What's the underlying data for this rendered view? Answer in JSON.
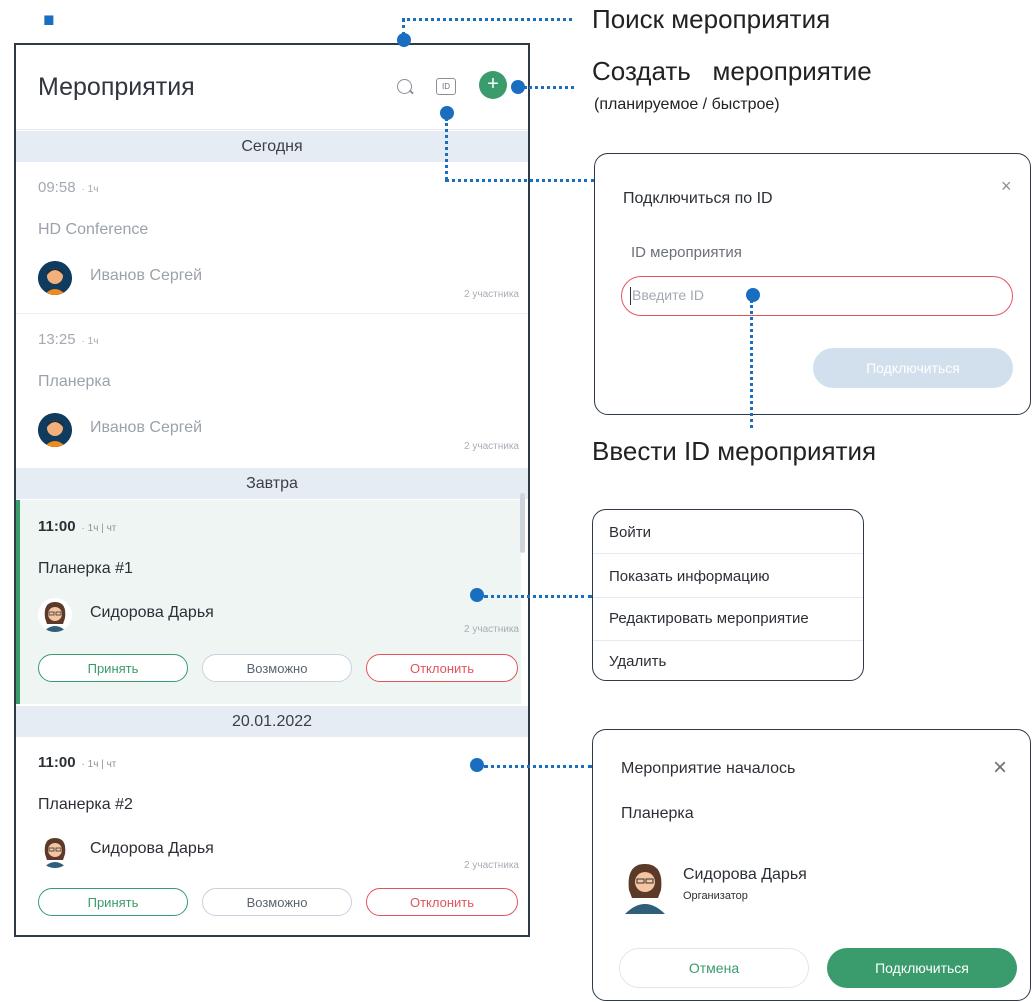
{
  "panel": {
    "title": "Мероприятия",
    "id_button": "ID",
    "add_button": "+"
  },
  "groups": [
    {
      "label": "Сегодня"
    },
    {
      "label": "Завтра"
    },
    {
      "label": "20.01.2022"
    }
  ],
  "events": [
    {
      "time": "09:58",
      "meta": "· 1ч",
      "name": "HD Conference",
      "organizer": "Иванов Сергей",
      "participants": "2 участника"
    },
    {
      "time": "13:25",
      "meta": "· 1ч",
      "name": "Планерка",
      "organizer": "Иванов Сергей",
      "participants": "2 участника"
    },
    {
      "time": "11:00",
      "meta": "· 1ч | чт",
      "name": "Планерка #1",
      "organizer": "Сидорова Дарья",
      "participants": "2 участника"
    },
    {
      "time": "11:00",
      "meta": "· 1ч | чт",
      "name": "Планерка #2",
      "organizer": "Сидорова Дарья",
      "participants": "2 участника"
    }
  ],
  "actions": {
    "accept": "Принять",
    "maybe": "Возможно",
    "decline": "Отклонить"
  },
  "callouts": {
    "search": "Поиск мероприятия",
    "create": "Создать   мероприятие",
    "create_sub": "(планируемое / быстрое)",
    "enter_id": "Ввести ID мероприятия"
  },
  "join_dialog": {
    "title": "Подключиться по ID",
    "field_label": "ID мероприятия",
    "placeholder": "Введите ID",
    "connect": "Подключиться",
    "close": "×"
  },
  "context_menu": {
    "items": [
      "Войти",
      "Показать информацию",
      "Редактировать мероприятие",
      "Удалить"
    ]
  },
  "started_dialog": {
    "title": "Мероприятие началось",
    "event": "Планерка",
    "person": "Сидорова Дарья",
    "role": "Организатор",
    "cancel": "Отмена",
    "connect": "Подключиться",
    "close": "×"
  },
  "colors": {
    "accent_blue": "#1a6ec0",
    "green": "#3a9b6c",
    "red": "#e0555c"
  }
}
